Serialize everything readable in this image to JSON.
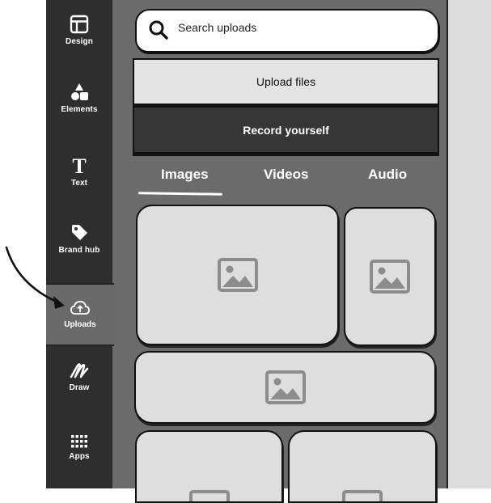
{
  "sidebar": {
    "items": [
      {
        "label": "Design",
        "icon": "layout-icon"
      },
      {
        "label": "Elements",
        "icon": "shapes-icon"
      },
      {
        "label": "Text",
        "icon": "text-icon"
      },
      {
        "label": "Brand hub",
        "icon": "tag-icon"
      },
      {
        "label": "Uploads",
        "icon": "cloud-upload-icon",
        "active": true
      },
      {
        "label": "Draw",
        "icon": "draw-icon"
      },
      {
        "label": "Apps",
        "icon": "apps-grid-icon"
      }
    ]
  },
  "search": {
    "placeholder": "Search uploads"
  },
  "buttons": {
    "upload": "Upload files",
    "record": "Record yourself"
  },
  "tabs": [
    {
      "label": "Images",
      "active": true
    },
    {
      "label": "Videos"
    },
    {
      "label": "Audio"
    }
  ],
  "colors": {
    "panel": "#6b6b6b",
    "sidebar": "#2e2e2e",
    "active_item": "#6a6a6a",
    "thumb": "#dedede"
  }
}
